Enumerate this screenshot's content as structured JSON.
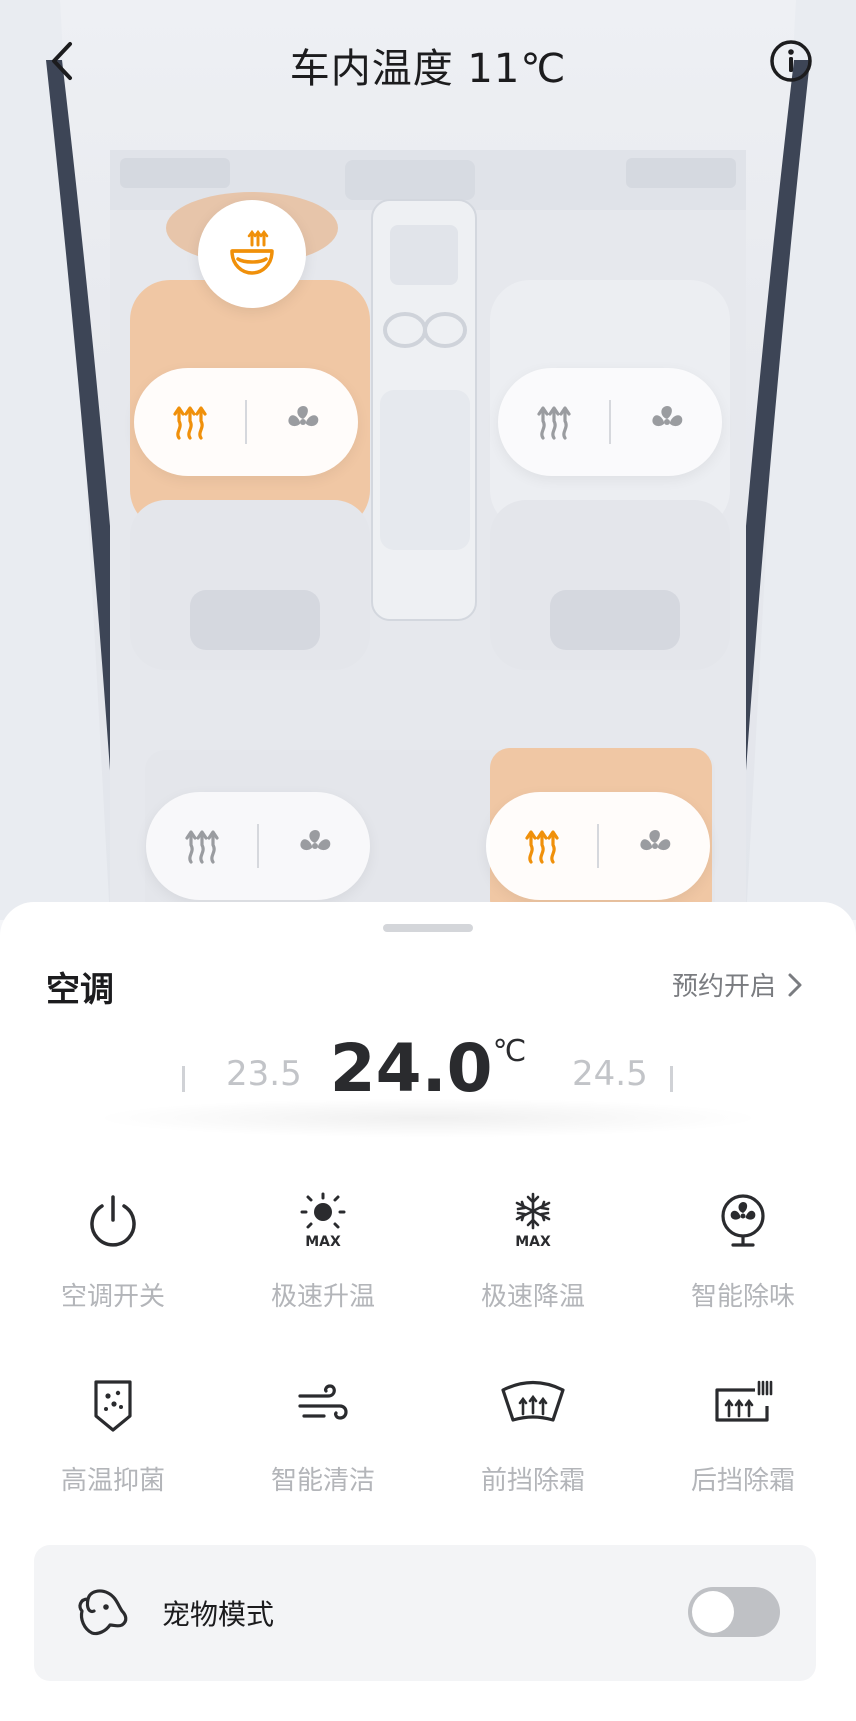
{
  "header": {
    "title": "车内温度 11℃"
  },
  "seats": {
    "front_left": {
      "heat_on": true
    },
    "front_right": {
      "heat_on": false
    },
    "rear_left": {
      "heat_on": false
    },
    "rear_right": {
      "heat_on": true
    },
    "steering_heat_on": true
  },
  "colors": {
    "accent": "#f0900a",
    "inactive": "#9a9ca0",
    "seat_heat": "#f0c7a4"
  },
  "climate": {
    "section_title": "空调",
    "schedule_label": "预约开启",
    "temperature": {
      "current": "24.0",
      "unit": "℃",
      "prev": "23.5",
      "next": "24.5"
    },
    "functions": [
      {
        "label": "空调开关",
        "icon": "power-icon"
      },
      {
        "label": "极速升温",
        "icon": "sun-max-icon"
      },
      {
        "label": "极速降温",
        "icon": "snowflake-max-icon"
      },
      {
        "label": "智能除味",
        "icon": "fan-icon"
      },
      {
        "label": "高温抑菌",
        "icon": "shield-bacteria-icon"
      },
      {
        "label": "智能清洁",
        "icon": "wind-icon"
      },
      {
        "label": "前挡除霜",
        "icon": "front-defrost-icon"
      },
      {
        "label": "后挡除霜",
        "icon": "rear-defrost-icon"
      }
    ],
    "pet_mode": {
      "label": "宠物模式",
      "enabled": false
    }
  }
}
